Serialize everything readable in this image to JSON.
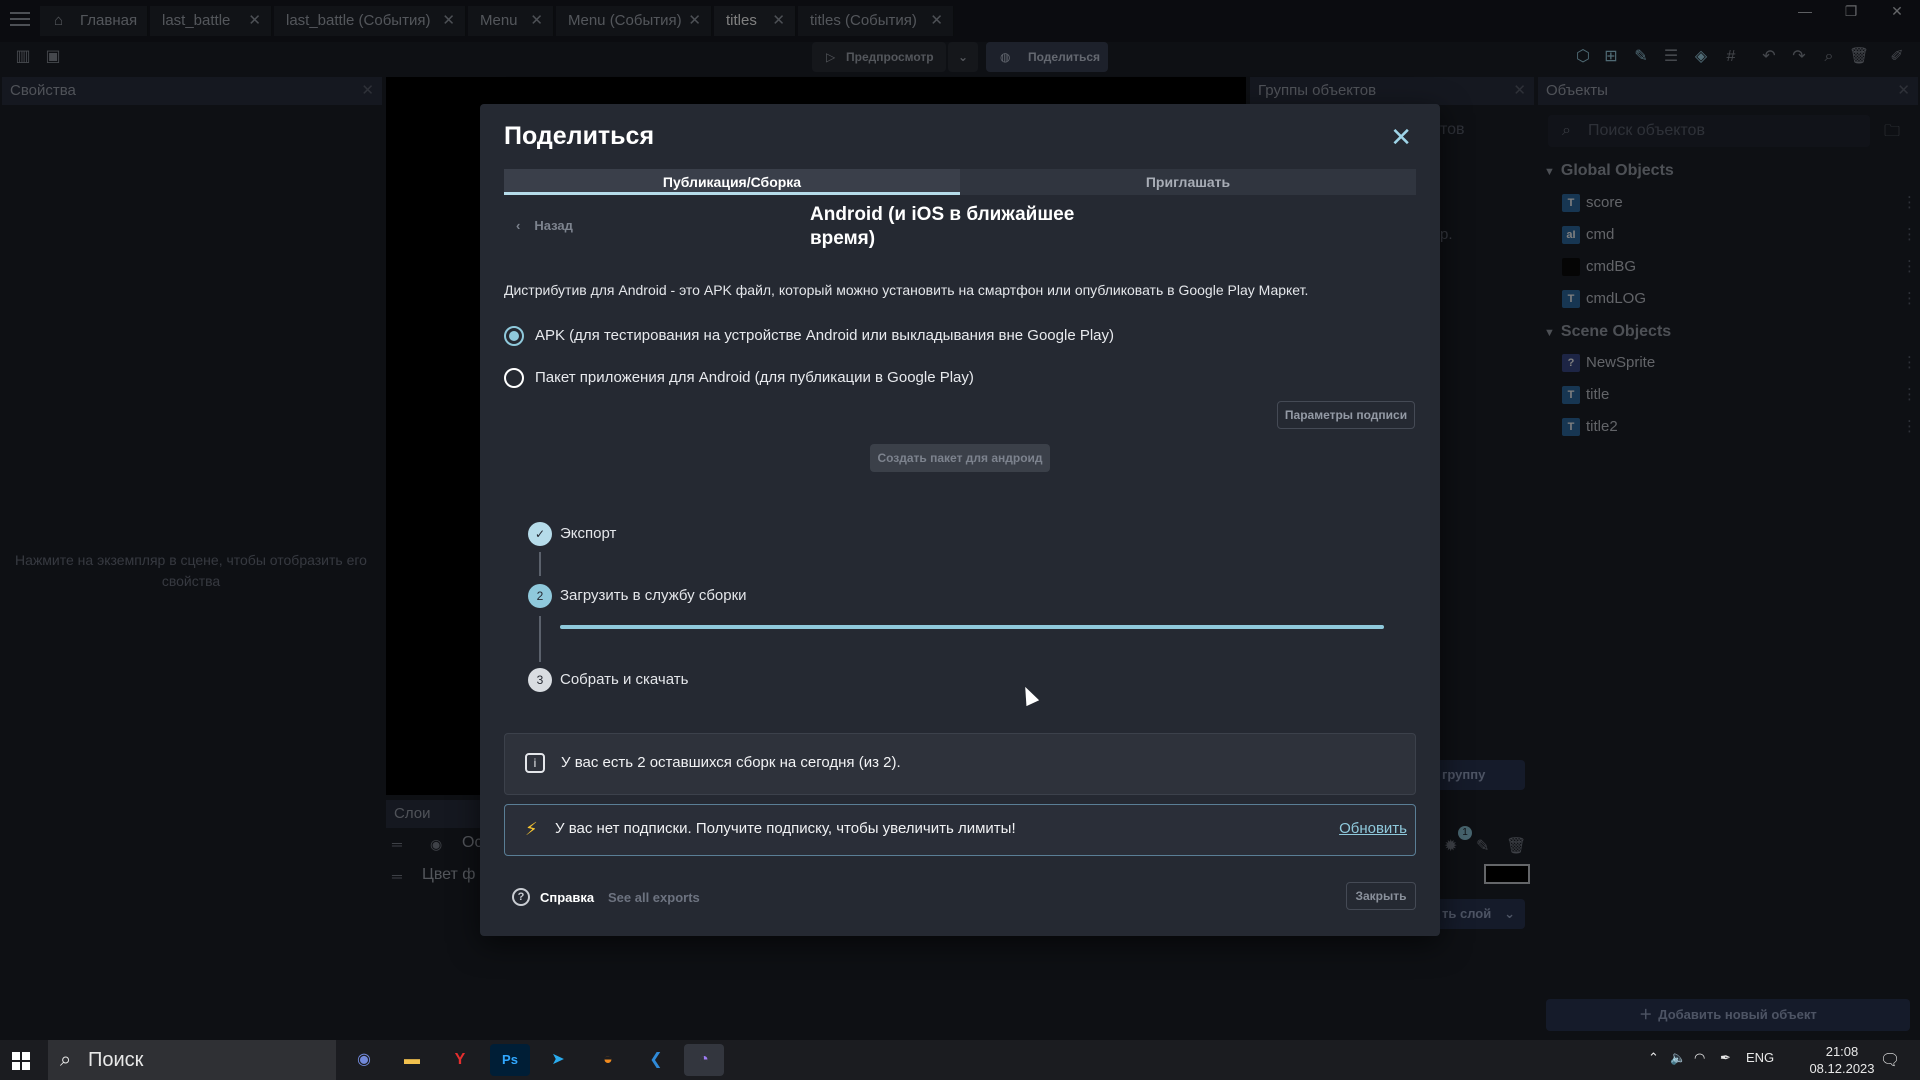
{
  "tabs": [
    {
      "label": "Главная"
    },
    {
      "label": "last_battle"
    },
    {
      "label": "last_battle (События)"
    },
    {
      "label": "Menu"
    },
    {
      "label": "Menu (События)"
    },
    {
      "label": "titles"
    },
    {
      "label": "titles (События)"
    }
  ],
  "toolbar": {
    "preview": "Предпросмотр",
    "share": "Поделиться"
  },
  "properties": {
    "title": "Свойства",
    "hint": "Нажмите на экземпляр в сцене, чтобы отобразить его свойства"
  },
  "groups": {
    "title": "Группы объектов",
    "partial": "тов",
    "partial2": "р.",
    "add_group": "группу"
  },
  "objects": {
    "title": "Объекты",
    "search_placeholder": "Поиск объектов",
    "global_title": "Global Objects",
    "global": [
      {
        "name": "score",
        "icon": "T"
      },
      {
        "name": "cmd",
        "icon": "aI"
      },
      {
        "name": "cmdBG",
        "icon": ""
      },
      {
        "name": "cmdLOG",
        "icon": "T"
      }
    ],
    "scene_title": "Scene Objects",
    "scene": [
      {
        "name": "NewSprite",
        "icon": "?"
      },
      {
        "name": "title",
        "icon": "T"
      },
      {
        "name": "title2",
        "icon": "T"
      }
    ],
    "add_button": "Добавить новый объект"
  },
  "layers": {
    "title": "Слои",
    "row1": "Ос",
    "row2": "Цвет ф",
    "add_layer": "ть слой",
    "badge": "1"
  },
  "modal": {
    "title": "Поделиться",
    "tab_publish": "Публикация/Сборка",
    "tab_invite": "Приглашать",
    "back": "Назад",
    "heading": "Android (и iOS в ближайшее время)",
    "description": "Дистрибутив для Android - это APK файл, который можно установить на смартфон или опубликовать в Google Play Маркет.",
    "option_apk": "APK (для тестирования на устройстве Android или выкладывания вне Google Play)",
    "option_aab": "Пакет приложения для Android (для публикации в Google Play)",
    "signing_button": "Параметры подписи",
    "build_button": "Создать пакет для андроид",
    "steps": [
      {
        "num": "✓",
        "label": "Экспорт"
      },
      {
        "num": "2",
        "label": "Загрузить в службу сборки"
      },
      {
        "num": "3",
        "label": "Собрать и скачать"
      }
    ],
    "upload_progress": 1.0,
    "info_builds": "У вас есть 2 оставшихся сборк на сегодня (из 2).",
    "info_subscription": "У вас нет подписки. Получите подписку, чтобы увеличить лимиты!",
    "update_link": "Обновить",
    "help": "Справка",
    "see_all": "See all exports",
    "close": "Закрыть"
  },
  "taskbar": {
    "search": "Поиск",
    "lang": "ENG",
    "time": "21:08",
    "date": "08.12.2023"
  },
  "colors": {
    "accent": "#8fc9dc",
    "background": "#1d2029",
    "modal": "#252932"
  }
}
